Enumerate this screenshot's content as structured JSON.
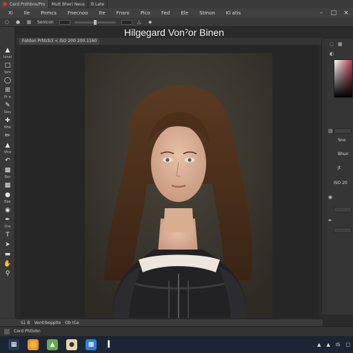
{
  "window_tabs": [
    {
      "label": "Cerd  Pnthbos/Pro"
    },
    {
      "label": "Mutt  Bheri Neus"
    },
    {
      "label": "B  Late"
    }
  ],
  "menu": [
    "Xi",
    "Ile",
    "Pnmcs",
    "Fnecnoo",
    "Ite",
    "Fnsro",
    "Pico",
    "Fed",
    "Ele",
    "Stmon",
    "Kl  atis"
  ],
  "options_bar": {
    "label": "Sonicon"
  },
  "document": {
    "title": "Hilgegard Vonˀor Binen",
    "tab_label": "Fohten Prhtcb3 < ISO 200 200.1160"
  },
  "toolbar": {
    "labels": [
      "Ionel",
      "Ipro",
      "Pr e",
      "Siou",
      "Nhe",
      "Vtre",
      "Ber",
      "Epe",
      "Ore"
    ]
  },
  "right_panel": {
    "labels": [
      "Sno",
      "Bhun",
      "Jt",
      "ISO 20"
    ]
  },
  "status": {
    "zoom": "S1 B",
    "info": "Ventrbopplte",
    "extra": "Ob ICe"
  },
  "app_status": {
    "label": "Cerd  Phtlobn"
  },
  "taskbar": {
    "tray_text": "IS",
    "icons": [
      "windows-icon",
      "browser-icon",
      "folder-icon",
      "photoshop-icon",
      "app-icon"
    ]
  },
  "colors": {
    "accent": "#d2382d",
    "panel_bg": "#383838",
    "canvas_bg": "#262626",
    "taskbar_bg": "#1b2533",
    "picker_hue": "#b0394d"
  }
}
